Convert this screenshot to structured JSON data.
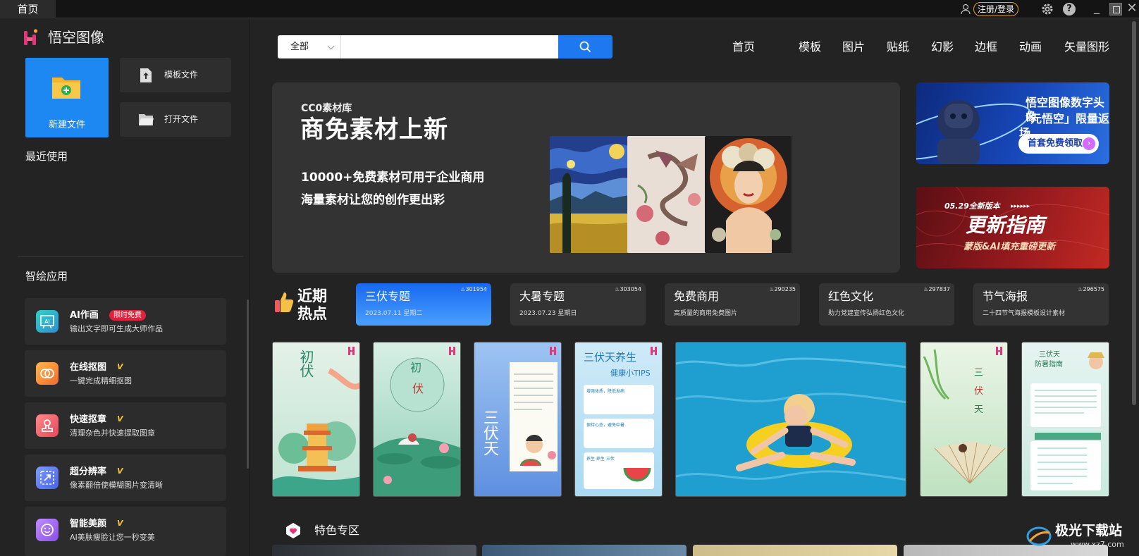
{
  "window": {
    "tab": "首页",
    "login": "注册/登录",
    "help": "?"
  },
  "sidebar": {
    "app_name": "悟空图像",
    "new_file": "新建文件",
    "template_file": "模板文件",
    "open_file": "打开文件",
    "recent": "最近使用",
    "apps_title": "智绘应用",
    "free_badge": "限时免费",
    "apps": [
      {
        "title": "AI作画",
        "desc": "输出文字即可生成大师作品"
      },
      {
        "title": "在线抠图",
        "desc": "一键完成精细抠图"
      },
      {
        "title": "快速抠章",
        "desc": "清理杂色并快速提取图章"
      },
      {
        "title": "超分辨率",
        "desc": "像素翻倍使模糊图片变清晰"
      },
      {
        "title": "智能美颜",
        "desc": "AI美肤瘦脸让您一秒变美"
      }
    ]
  },
  "search": {
    "category": "全部",
    "placeholder": ""
  },
  "nav": [
    "首页",
    "模板",
    "图片",
    "贴纸",
    "幻影",
    "边框",
    "动画",
    "矢量图形"
  ],
  "banner": {
    "tag": "CC0素材库",
    "title": "商免素材上新",
    "line1": "10000+免费素材可用于企业商用",
    "line2": "海量素材让您的创作更出彩"
  },
  "promo1": {
    "line1": "悟空图像数字头像",
    "line2": "「元悟空」限量返场",
    "button": "首套免费领取"
  },
  "promo2": {
    "date": "05.29全新版本",
    "arrows": "▸▸▸▸▸▸",
    "title": "更新指南",
    "sub": "蒙版&AI填充重磅更新"
  },
  "hot": {
    "title_1": "近期",
    "title_2": "热点",
    "cards": [
      {
        "title": "三伏专题",
        "sub": "2023.07.11 星期二",
        "count": "301954"
      },
      {
        "title": "大暑专题",
        "sub": "2023.07.23 星期日",
        "count": "303054"
      },
      {
        "title": "免费商用",
        "sub": "高质量的商用免费图片",
        "count": "290235"
      },
      {
        "title": "红色文化",
        "sub": "助力党建宣传弘扬红色文化",
        "count": "297837"
      },
      {
        "title": "节气海报",
        "sub": "二十四节气海报模板设计素材",
        "count": "296575"
      }
    ]
  },
  "templates": {
    "t1": "初伏",
    "t2_a": "初",
    "t2_b": "伏",
    "t3": "三伏天",
    "t4_title": "三伏天养生",
    "t4_sub": "健康小TIPS",
    "t4_box1": "增强体质，降低发病",
    "t4_box2": "保持心态，避免中暑",
    "t4_box3": "养生 养生 三伏",
    "t6_a": "三",
    "t6_b": "伏",
    "t6_c": "天",
    "t7_title": "三伏天",
    "t7_sub": "防暑指南"
  },
  "featured": {
    "title": "特色专区"
  },
  "watermark": {
    "text": "极光下载站",
    "url": "www.xz7.com"
  },
  "colors": {
    "accent": "#1e78f0",
    "vip": "#f2c23a",
    "badge": "#e0223c",
    "login_border": "#d9a43a"
  }
}
